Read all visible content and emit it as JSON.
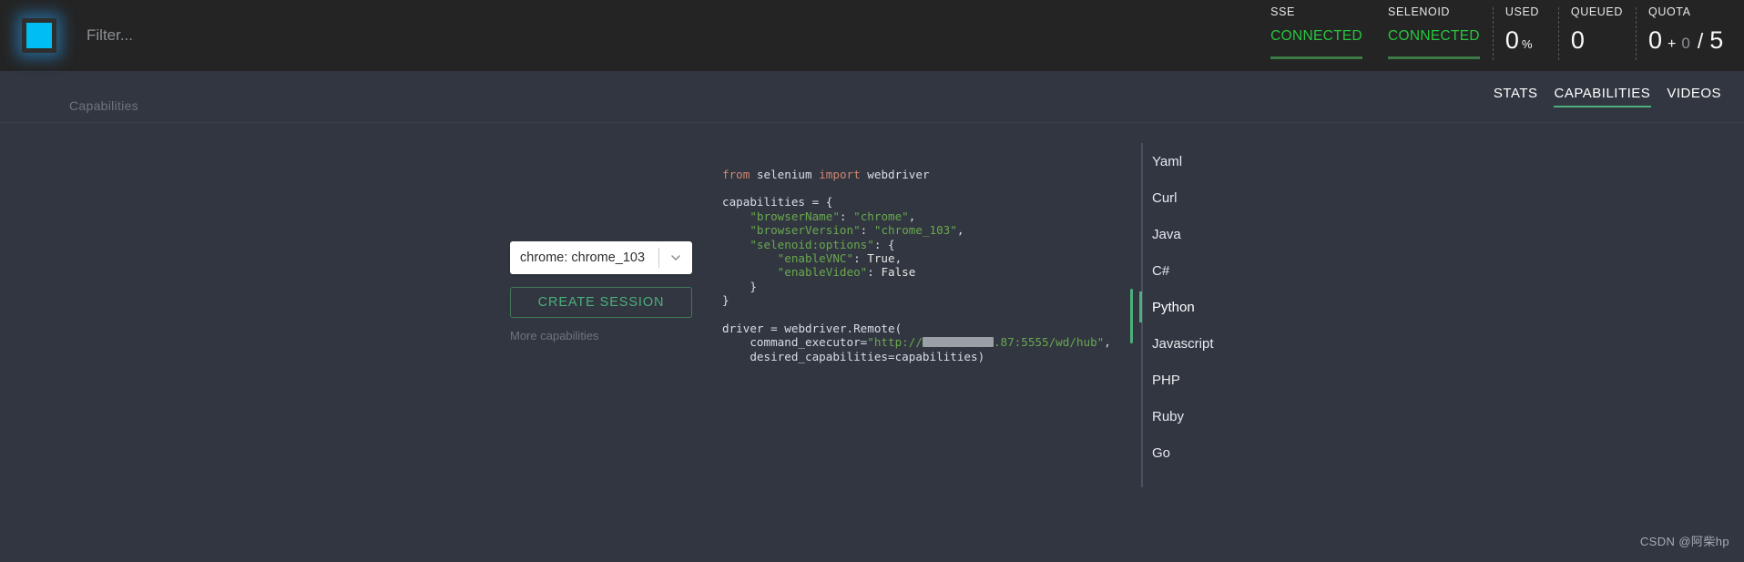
{
  "header": {
    "logo_name": "selenoid-logo",
    "filter": {
      "placeholder": "Filter...",
      "value": ""
    },
    "stats": [
      {
        "label": "SSE",
        "type": "status",
        "value": "CONNECTED"
      },
      {
        "label": "SELENOID",
        "type": "status",
        "value": "CONNECTED"
      },
      {
        "label": "USED",
        "type": "percent",
        "value": "0",
        "unit": "%"
      },
      {
        "label": "QUEUED",
        "type": "number",
        "value": "0"
      },
      {
        "label": "QUOTA",
        "type": "quota",
        "value": "0",
        "plus": "+",
        "pending": "0",
        "slash": "/",
        "total": "5"
      }
    ]
  },
  "tabs": [
    {
      "label": "STATS",
      "active": false
    },
    {
      "label": "CAPABILITIES",
      "active": true
    },
    {
      "label": "VIDEOS",
      "active": false
    }
  ],
  "section": {
    "title": "Capabilities"
  },
  "controls": {
    "browser_select": {
      "value": "chrome: chrome_103",
      "options": [
        "chrome: chrome_103"
      ]
    },
    "create_session_label": "CREATE SESSION",
    "more_capabilities_label": "More capabilities"
  },
  "languages": [
    {
      "label": "Yaml",
      "active": false
    },
    {
      "label": "Curl",
      "active": false
    },
    {
      "label": "Java",
      "active": false
    },
    {
      "label": "C#",
      "active": false
    },
    {
      "label": "Python",
      "active": true
    },
    {
      "label": "Javascript",
      "active": false
    },
    {
      "label": "PHP",
      "active": false
    },
    {
      "label": "Ruby",
      "active": false
    },
    {
      "label": "Go",
      "active": false
    }
  ],
  "code": {
    "language": "Python",
    "lines": [
      "from selenium import webdriver",
      "",
      "capabilities = {",
      "    \"browserName\": \"chrome\",",
      "    \"browserVersion\": \"chrome_103\",",
      "    \"selenoid:options\": {",
      "        \"enableVNC\": True,",
      "        \"enableVideo\": False",
      "    }",
      "}",
      "",
      "driver = webdriver.Remote(",
      "    command_executor=\"http://[REDACTED].87:5555/wd/hub\",",
      "    desired_capabilities=capabilities)"
    ],
    "redacted_host_suffix": ".87:5555/wd/hub"
  },
  "watermark": "CSDN @阿柴hp",
  "colors": {
    "header_bg": "#242424",
    "body_bg": "#313640",
    "accent_green": "#4caf7d",
    "status_green": "#28c53f",
    "logo_cyan": "#00bdf2",
    "muted_text": "#6e747e"
  }
}
